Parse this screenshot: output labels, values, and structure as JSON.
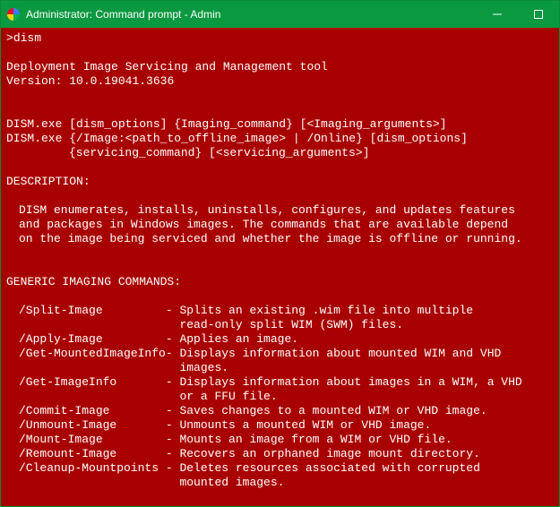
{
  "titlebar": {
    "title": "Administrator: Command prompt - Admin"
  },
  "prompt": ">",
  "command": "dism",
  "tool_name": "Deployment Image Servicing and Management tool",
  "version_label": "Version:",
  "version_value": "10.0.19041.3636",
  "usage_line1": "DISM.exe [dism_options] {Imaging_command} [<Imaging_arguments>]",
  "usage_line2": "DISM.exe {/Image:<path_to_offline_image> | /Online} [dism_options]",
  "usage_line3": "{servicing_command} [<servicing_arguments>]",
  "description_header": "DESCRIPTION:",
  "description_l1": "DISM enumerates, installs, uninstalls, configures, and updates features",
  "description_l2": "and packages in Windows images. The commands that are available depend",
  "description_l3": "on the image being serviced and whether the image is offline or running.",
  "generic_header": "GENERIC IMAGING COMMANDS:",
  "commands": [
    {
      "name": "/Split-Image",
      "desc": "Splits an existing .wim file into multiple\nread-only split WIM (SWM) files."
    },
    {
      "name": "/Apply-Image",
      "desc": "Applies an image."
    },
    {
      "name": "/Get-MountedImageInfo",
      "desc": "Displays information about mounted WIM and VHD\nimages."
    },
    {
      "name": "/Get-ImageInfo",
      "desc": "Displays information about images in a WIM, a VHD\nor a FFU file."
    },
    {
      "name": "/Commit-Image",
      "desc": "Saves changes to a mounted WIM or VHD image."
    },
    {
      "name": "/Unmount-Image",
      "desc": "Unmounts a mounted WIM or VHD image."
    },
    {
      "name": "/Mount-Image",
      "desc": "Mounts an image from a WIM or VHD file."
    },
    {
      "name": "/Remount-Image",
      "desc": "Recovers an orphaned image mount directory."
    },
    {
      "name": "/Cleanup-Mountpoints",
      "desc": "Deletes resources associated with corrupted\nmounted images."
    }
  ]
}
